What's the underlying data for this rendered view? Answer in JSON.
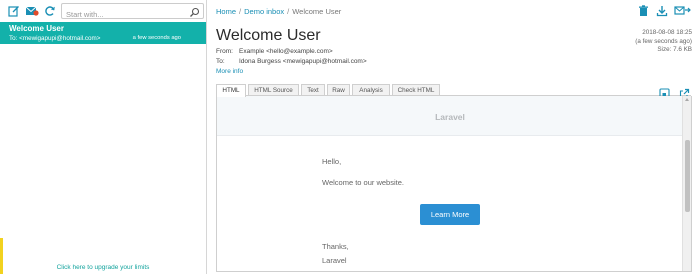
{
  "sidebar": {
    "search_placeholder": "Start with...",
    "icons": [
      "compose-icon",
      "mail-check-icon",
      "refresh-icon",
      "search-icon"
    ],
    "message": {
      "subject": "Welcome User",
      "to": "To: <mewigapupi@hotmail.com>",
      "time": "a few seconds ago"
    },
    "upgrade_text": "Click here to upgrade your limits"
  },
  "breadcrumb": {
    "home": "Home",
    "inbox": "Demo inbox",
    "current": "Welcome User",
    "separator": "/"
  },
  "email": {
    "subject": "Welcome User",
    "from_label": "From:",
    "from": "Example <hello@example.com>",
    "to_label": "To:",
    "to": "Idona Burgess <mewigapupi@hotmail.com>",
    "more_info": "More info",
    "date": "2018-08-08 18:25",
    "relative_time": "(a few seconds ago)",
    "size": "Size: 7.6 KB"
  },
  "tabs": [
    "HTML",
    "HTML Source",
    "Text",
    "Raw",
    "Analysis",
    "Check HTML"
  ],
  "content": {
    "brand": "Laravel",
    "greeting": "Hello,",
    "body": "Welcome to our website.",
    "button": "Learn More",
    "signoff": "Thanks,",
    "signature": "Laravel"
  },
  "colors": {
    "accent": "#13b1aa",
    "link": "#1a8fb5",
    "button": "#2b8fd3",
    "upgrade_marker": "#f2d21f"
  }
}
